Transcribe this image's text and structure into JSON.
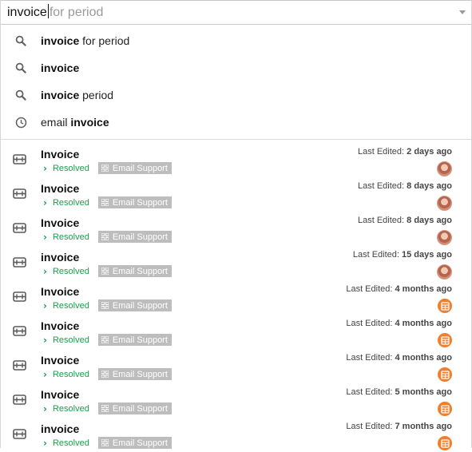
{
  "search": {
    "typed": "invoice",
    "completion_hint": "for period",
    "dropdown_icon": "chevron-down-icon"
  },
  "suggestions": [
    {
      "type": "search",
      "icon": "search-icon",
      "parts": [
        {
          "text": "invoice",
          "bold": true
        },
        {
          "text": " for period",
          "bold": false
        }
      ]
    },
    {
      "type": "search",
      "icon": "search-icon",
      "parts": [
        {
          "text": "invoice",
          "bold": true
        }
      ]
    },
    {
      "type": "search",
      "icon": "search-icon",
      "parts": [
        {
          "text": "invoice",
          "bold": true
        },
        {
          "text": " period",
          "bold": false
        }
      ]
    },
    {
      "type": "history",
      "icon": "history-clock-icon",
      "parts": [
        {
          "text": "email ",
          "bold": false
        },
        {
          "text": "invoice",
          "bold": true
        }
      ]
    }
  ],
  "results": [
    {
      "title": "Invoice",
      "status": "Resolved",
      "tag": "Email Support",
      "edited_label": "Last Edited:",
      "edited_value": "2 days ago",
      "avatar": "user-photo"
    },
    {
      "title": "Invoice",
      "status": "Resolved",
      "tag": "Email Support",
      "edited_label": "Last Edited:",
      "edited_value": "8 days ago",
      "avatar": "user-photo"
    },
    {
      "title": "Invoice",
      "status": "Resolved",
      "tag": "Email Support",
      "edited_label": "Last Edited:",
      "edited_value": "8 days ago",
      "avatar": "user-photo"
    },
    {
      "title": "invoice",
      "status": "Resolved",
      "tag": "Email Support",
      "edited_label": "Last Edited:",
      "edited_value": "15 days ago",
      "avatar": "user-photo"
    },
    {
      "title": "Invoice",
      "status": "Resolved",
      "tag": "Email Support",
      "edited_label": "Last Edited:",
      "edited_value": "4 months ago",
      "avatar": "org-icon"
    },
    {
      "title": "Invoice",
      "status": "Resolved",
      "tag": "Email Support",
      "edited_label": "Last Edited:",
      "edited_value": "4 months ago",
      "avatar": "org-icon"
    },
    {
      "title": "Invoice",
      "status": "Resolved",
      "tag": "Email Support",
      "edited_label": "Last Edited:",
      "edited_value": "4 months ago",
      "avatar": "org-icon"
    },
    {
      "title": "Invoice",
      "status": "Resolved",
      "tag": "Email Support",
      "edited_label": "Last Edited:",
      "edited_value": "5 months ago",
      "avatar": "org-icon"
    },
    {
      "title": "invoice",
      "status": "Resolved",
      "tag": "Email Support",
      "edited_label": "Last Edited:",
      "edited_value": "7 months ago",
      "avatar": "org-icon"
    }
  ],
  "colors": {
    "resolved": "#1b9e4b",
    "tag_bg": "#bdbdbd",
    "org_avatar": "#ee7f2d",
    "icon_gray": "#616161"
  }
}
